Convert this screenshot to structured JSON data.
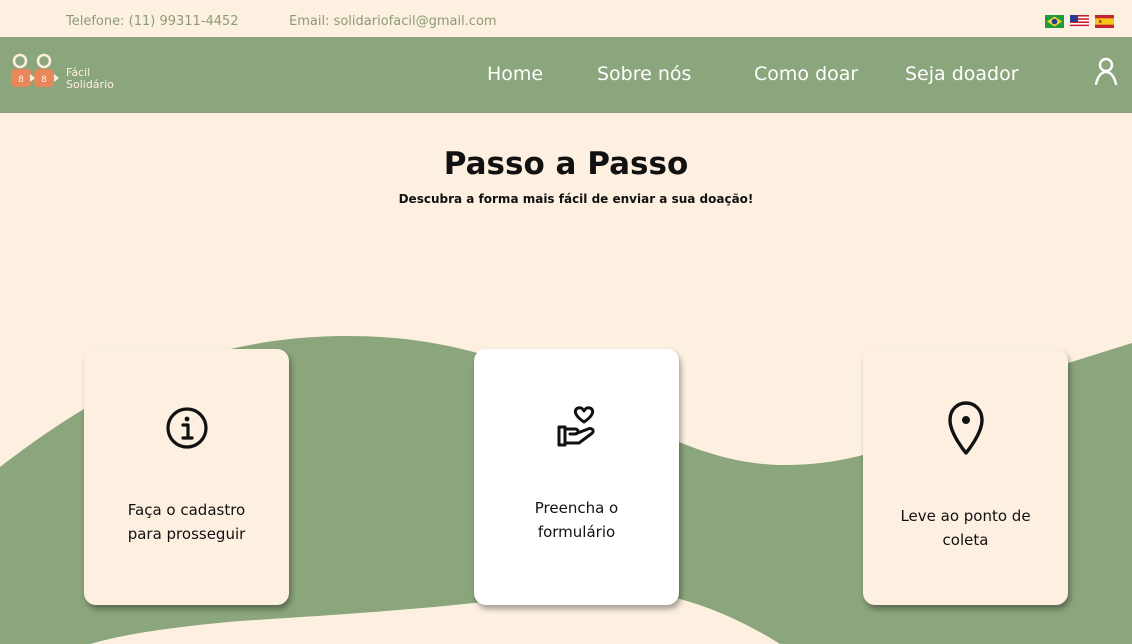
{
  "topbar": {
    "phone": "Telefone: (11) 99311-4452",
    "email": "Email: solidariofacil@gmail.com",
    "languages": [
      "pt-BR",
      "en-US",
      "es"
    ]
  },
  "header": {
    "logo_line1": "Fácil",
    "logo_line2": "Solidário",
    "nav": {
      "home": "Home",
      "sobre": "Sobre nós",
      "como": "Como doar",
      "seja": "Seja doador"
    },
    "user_icon": "user-icon"
  },
  "main": {
    "title": "Passo a Passo",
    "subtitle": "Descubra a forma mais fácil de enviar a sua doação!",
    "steps": [
      {
        "icon": "info-icon",
        "label_line1": "Faça o cadastro",
        "label_line2": "para prosseguir"
      },
      {
        "icon": "heart-hand-icon",
        "label_line1": "Preencha o",
        "label_line2": "formulário"
      },
      {
        "icon": "location-pin-icon",
        "label_line1": "Leve ao ponto de",
        "label_line2": "coleta"
      }
    ]
  },
  "colors": {
    "background": "#fdf0e1",
    "accent_green": "#8ba57c",
    "topbar_text": "#8b9c72",
    "logo_orange": "#e8875a"
  }
}
